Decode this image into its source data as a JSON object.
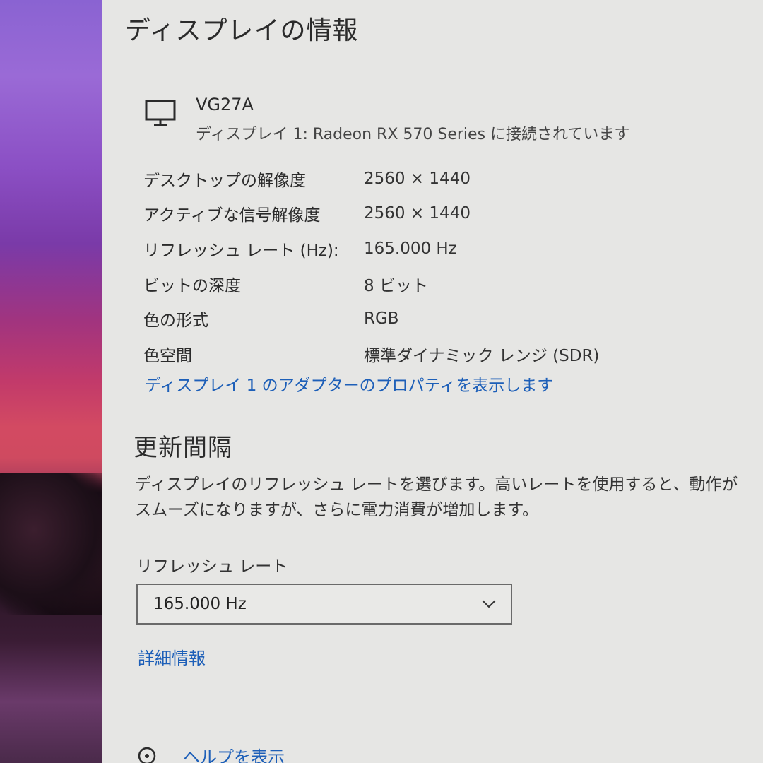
{
  "page": {
    "title": "ディスプレイの情報"
  },
  "monitor": {
    "name": "VG27A",
    "connection": "ディスプレイ 1: Radeon RX 570 Series に接続されています",
    "icon": "monitor-icon"
  },
  "info_rows": [
    {
      "label": "デスクトップの解像度",
      "value": "2560 × 1440"
    },
    {
      "label": "アクティブな信号解像度",
      "value": "2560 × 1440"
    },
    {
      "label": "リフレッシュ レート (Hz):",
      "value": "165.000 Hz"
    },
    {
      "label": "ビットの深度",
      "value": "8 ビット"
    },
    {
      "label": "色の形式",
      "value": "RGB"
    },
    {
      "label": "色空間",
      "value": "標準ダイナミック レンジ (SDR)"
    }
  ],
  "adapter_link": "ディスプレイ 1 のアダプターのプロパティを表示します",
  "refresh_section": {
    "title": "更新間隔",
    "description": "ディスプレイのリフレッシュ レートを選びます。高いレートを使用すると、動作がスムーズになりますが、さらに電力消費が増加します。",
    "dropdown_label": "リフレッシュ レート",
    "dropdown_value": "165.000 Hz",
    "dropdown_icon": "chevron-down-icon"
  },
  "details_link": "詳細情報",
  "help": {
    "label": "ヘルプを表示",
    "icon": "help-icon"
  },
  "colors": {
    "panel_background": "#e6e6e4",
    "link": "#1d5fb8",
    "text": "#2b2b2b"
  }
}
